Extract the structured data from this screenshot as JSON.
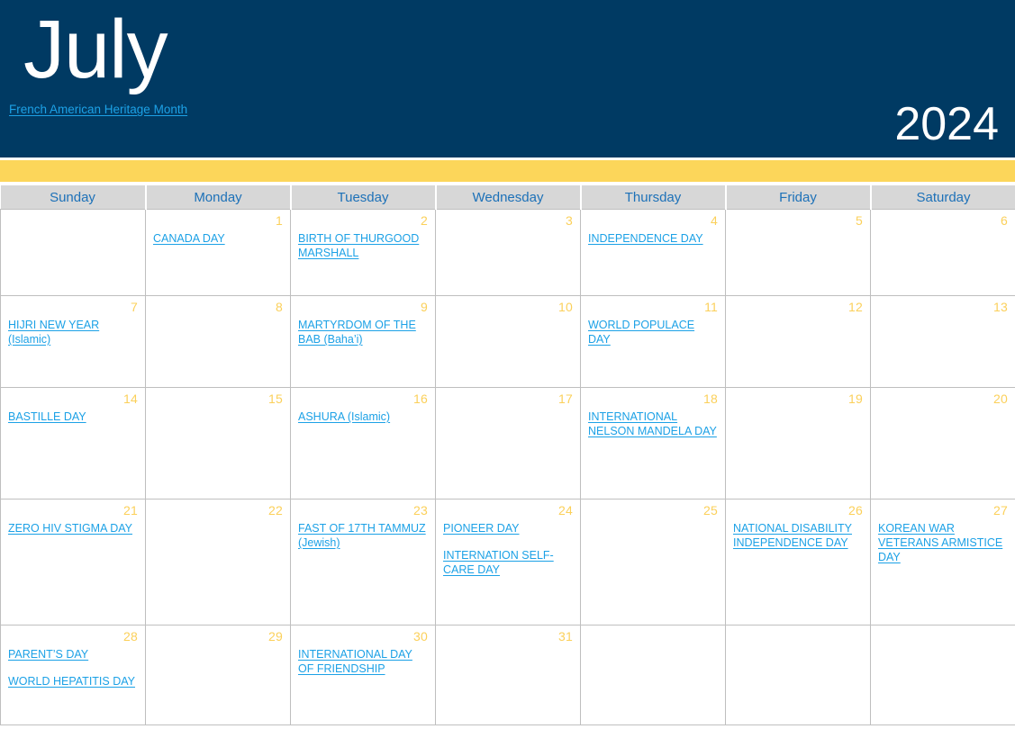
{
  "banner": {
    "month": "July",
    "subtitle": "French American Heritage Month",
    "year": "2024",
    "bg_color": "#003a63",
    "title_color": "#ffffff",
    "link_color": "#1ca1e6"
  },
  "accent_bar": {
    "color": "#fcd65a"
  },
  "weekday_headers": [
    {
      "label": "Sunday"
    },
    {
      "label": "Monday"
    },
    {
      "label": "Tuesday"
    },
    {
      "label": "Wednesday"
    },
    {
      "label": "Thursday"
    },
    {
      "label": "Friday"
    },
    {
      "label": "Saturday"
    }
  ],
  "header_style": {
    "bg_color": "#d7d7d7",
    "text_color": "#1d71b8"
  },
  "cell_style": {
    "day_number_color": "#fbd05a",
    "event_link_color": "#1ca1e6",
    "border_color": "#bfbfbf"
  },
  "weeks": [
    {
      "days": [
        {
          "num": "",
          "events": []
        },
        {
          "num": "1",
          "events": [
            "CANADA DAY"
          ]
        },
        {
          "num": "2",
          "events": [
            "BIRTH OF THURGOOD MARSHALL"
          ]
        },
        {
          "num": "3",
          "events": []
        },
        {
          "num": "4",
          "events": [
            "INDEPENDENCE DAY"
          ]
        },
        {
          "num": "5",
          "events": []
        },
        {
          "num": "6",
          "events": []
        }
      ]
    },
    {
      "days": [
        {
          "num": "7",
          "events": [
            "HIJRI NEW YEAR (Islamic)"
          ]
        },
        {
          "num": "8",
          "events": []
        },
        {
          "num": "9",
          "events": [
            "MARTYRDOM OF THE BAB (Baha’i)"
          ]
        },
        {
          "num": "10",
          "events": []
        },
        {
          "num": "11",
          "events": [
            "WORLD POPULACE DAY"
          ]
        },
        {
          "num": "12",
          "events": []
        },
        {
          "num": "13",
          "events": []
        }
      ]
    },
    {
      "days": [
        {
          "num": "14",
          "events": [
            "BASTILLE DAY"
          ]
        },
        {
          "num": "15",
          "events": []
        },
        {
          "num": "16",
          "events": [
            "ASHURA (Islamic)"
          ]
        },
        {
          "num": "17",
          "events": []
        },
        {
          "num": "18",
          "events": [
            "INTERNATIONAL NELSON MANDELA DAY"
          ]
        },
        {
          "num": "19",
          "events": []
        },
        {
          "num": "20",
          "events": []
        }
      ]
    },
    {
      "days": [
        {
          "num": "21",
          "events": [
            "ZERO HIV STIGMA DAY"
          ]
        },
        {
          "num": "22",
          "events": []
        },
        {
          "num": "23",
          "events": [
            "FAST OF 17TH TAMMUZ (Jewish)"
          ]
        },
        {
          "num": "24",
          "events": [
            "PIONEER DAY",
            "INTERNATION SELF-CARE DAY"
          ]
        },
        {
          "num": "25",
          "events": []
        },
        {
          "num": "26",
          "events": [
            "NATIONAL DISABILITY INDEPENDENCE DAY"
          ]
        },
        {
          "num": "27",
          "events": [
            "KOREAN WAR VETERANS ARMISTICE DAY"
          ]
        }
      ]
    },
    {
      "days": [
        {
          "num": "28",
          "events": [
            "PARENT’S DAY",
            "WORLD HEPATITIS DAY"
          ]
        },
        {
          "num": "29",
          "events": []
        },
        {
          "num": "30",
          "events": [
            "INTERNATIONAL DAY OF FRIENDSHIP"
          ]
        },
        {
          "num": "31",
          "events": []
        },
        {
          "num": "",
          "events": []
        },
        {
          "num": "",
          "events": []
        },
        {
          "num": "",
          "events": []
        }
      ]
    }
  ]
}
